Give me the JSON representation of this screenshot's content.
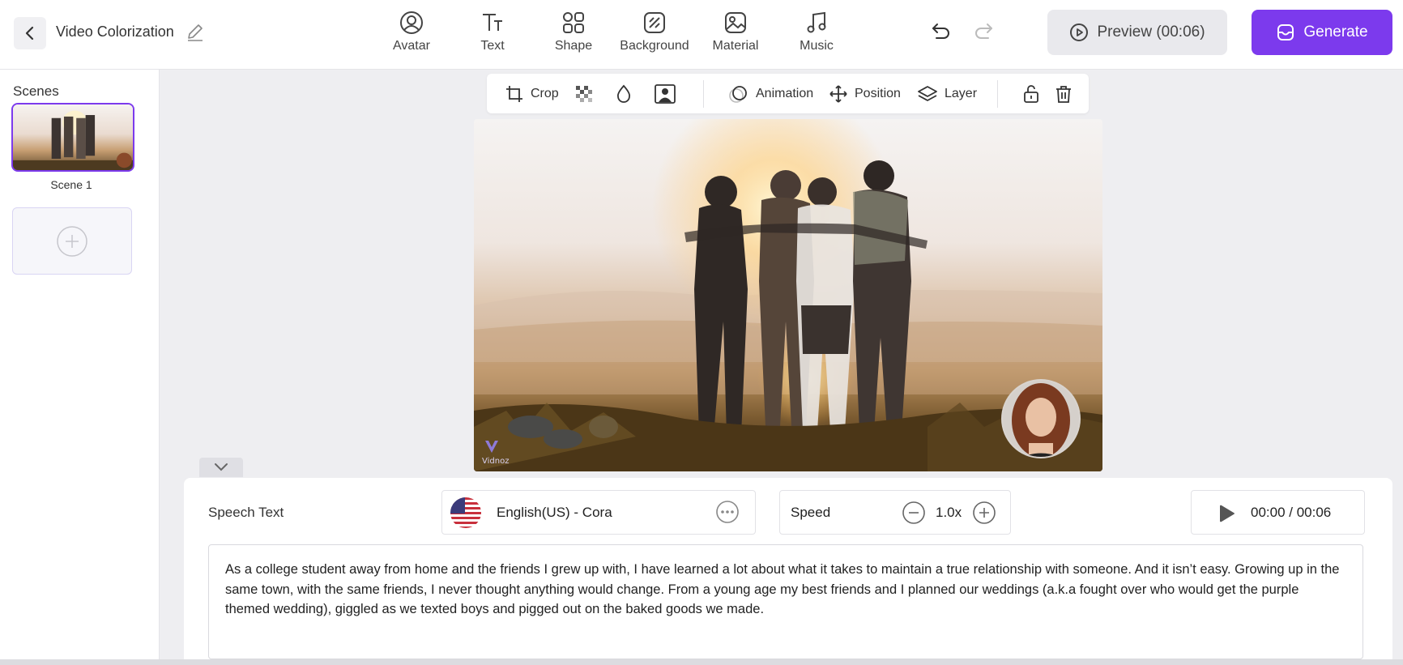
{
  "header": {
    "back_icon": "chevron-left-icon",
    "title": "Video Colorization",
    "edit_icon": "pencil-icon",
    "tools": [
      {
        "label": "Avatar",
        "icon": "avatar-icon"
      },
      {
        "label": "Text",
        "icon": "text-icon"
      },
      {
        "label": "Shape",
        "icon": "shape-icon"
      },
      {
        "label": "Background",
        "icon": "background-icon"
      },
      {
        "label": "Material",
        "icon": "image-icon"
      },
      {
        "label": "Music",
        "icon": "music-icon"
      }
    ],
    "preview_label": "Preview (00:06)",
    "generate_label": "Generate"
  },
  "sidebar": {
    "title": "Scenes",
    "scenes": [
      {
        "label": "Scene 1"
      }
    ]
  },
  "canvas_toolbar": {
    "crop": "Crop",
    "animation": "Animation",
    "position": "Position",
    "layer": "Layer"
  },
  "canvas": {
    "watermark": "Vidnoz"
  },
  "speech": {
    "label": "Speech Text",
    "voice": "English(US) - Cora",
    "speed_label": "Speed",
    "speed_value": "1.0x",
    "time": "00:00 / 00:06",
    "text": "As a college student away from home and the friends I grew up with, I have learned a lot about what it takes to maintain a true relationship with someone. And it isn’t easy. Growing up in the same town, with the same friends, I never thought anything would change. From a young age my best friends and I planned our weddings (a.k.a fought over who would get the purple themed wedding), giggled as we texted boys and pigged out on the baked goods we made."
  },
  "colors": {
    "accent": "#7c3aed",
    "background": "#eeeef1"
  }
}
